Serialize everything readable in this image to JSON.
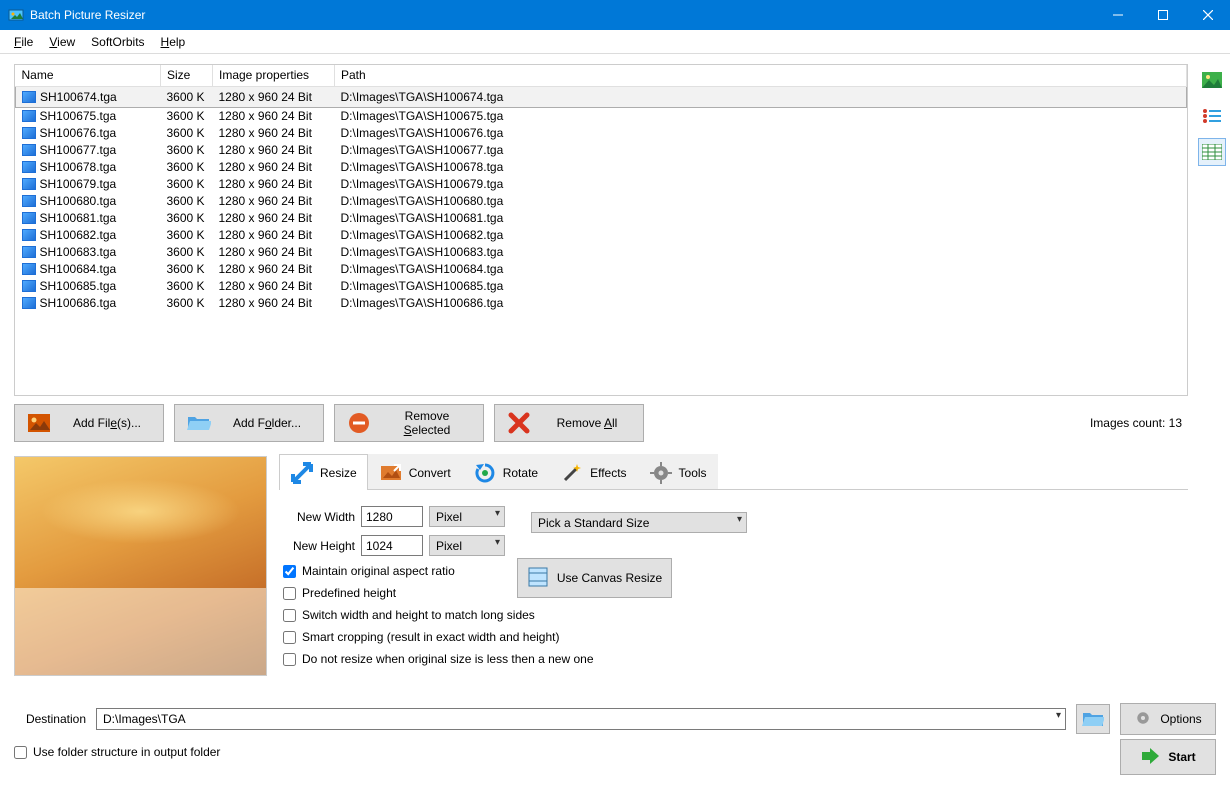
{
  "window": {
    "title": "Batch Picture Resizer"
  },
  "menu": {
    "file": "File",
    "view": "View",
    "softorbits": "SoftOrbits",
    "help": "Help"
  },
  "table": {
    "headers": {
      "name": "Name",
      "size": "Size",
      "props": "Image properties",
      "path": "Path"
    },
    "rows": [
      {
        "name": "SH100674.tga",
        "size": "3600 K",
        "props": "1280 x 960  24 Bit",
        "path": "D:\\Images\\TGA\\SH100674.tga"
      },
      {
        "name": "SH100675.tga",
        "size": "3600 K",
        "props": "1280 x 960  24 Bit",
        "path": "D:\\Images\\TGA\\SH100675.tga"
      },
      {
        "name": "SH100676.tga",
        "size": "3600 K",
        "props": "1280 x 960  24 Bit",
        "path": "D:\\Images\\TGA\\SH100676.tga"
      },
      {
        "name": "SH100677.tga",
        "size": "3600 K",
        "props": "1280 x 960  24 Bit",
        "path": "D:\\Images\\TGA\\SH100677.tga"
      },
      {
        "name": "SH100678.tga",
        "size": "3600 K",
        "props": "1280 x 960  24 Bit",
        "path": "D:\\Images\\TGA\\SH100678.tga"
      },
      {
        "name": "SH100679.tga",
        "size": "3600 K",
        "props": "1280 x 960  24 Bit",
        "path": "D:\\Images\\TGA\\SH100679.tga"
      },
      {
        "name": "SH100680.tga",
        "size": "3600 K",
        "props": "1280 x 960  24 Bit",
        "path": "D:\\Images\\TGA\\SH100680.tga"
      },
      {
        "name": "SH100681.tga",
        "size": "3600 K",
        "props": "1280 x 960  24 Bit",
        "path": "D:\\Images\\TGA\\SH100681.tga"
      },
      {
        "name": "SH100682.tga",
        "size": "3600 K",
        "props": "1280 x 960  24 Bit",
        "path": "D:\\Images\\TGA\\SH100682.tga"
      },
      {
        "name": "SH100683.tga",
        "size": "3600 K",
        "props": "1280 x 960  24 Bit",
        "path": "D:\\Images\\TGA\\SH100683.tga"
      },
      {
        "name": "SH100684.tga",
        "size": "3600 K",
        "props": "1280 x 960  24 Bit",
        "path": "D:\\Images\\TGA\\SH100684.tga"
      },
      {
        "name": "SH100685.tga",
        "size": "3600 K",
        "props": "1280 x 960  24 Bit",
        "path": "D:\\Images\\TGA\\SH100685.tga"
      },
      {
        "name": "SH100686.tga",
        "size": "3600 K",
        "props": "1280 x 960  24 Bit",
        "path": "D:\\Images\\TGA\\SH100686.tga"
      }
    ]
  },
  "buttons": {
    "add_files": "Add File(s)...",
    "add_folder": "Add Folder...",
    "remove_selected": "Remove Selected",
    "remove_all": "Remove All",
    "options": "Options",
    "start": "Start",
    "canvas": "Use Canvas Resize"
  },
  "count_label": "Images count:  13",
  "tabs": {
    "resize": "Resize",
    "convert": "Convert",
    "rotate": "Rotate",
    "effects": "Effects",
    "tools": "Tools"
  },
  "resize": {
    "width_label": "New Width",
    "height_label": "New Height",
    "width": "1280",
    "height": "1024",
    "unit": "Pixel",
    "standard": "Pick a Standard Size",
    "maintain": "Maintain original aspect ratio",
    "predef": "Predefined height",
    "switch": "Switch width and height to match long sides",
    "smart": "Smart cropping (result in exact width and height)",
    "noresize": "Do not resize when original size is less then a new one"
  },
  "dest": {
    "label": "Destination",
    "value": "D:\\Images\\TGA",
    "use_structure": "Use folder structure in output folder"
  }
}
